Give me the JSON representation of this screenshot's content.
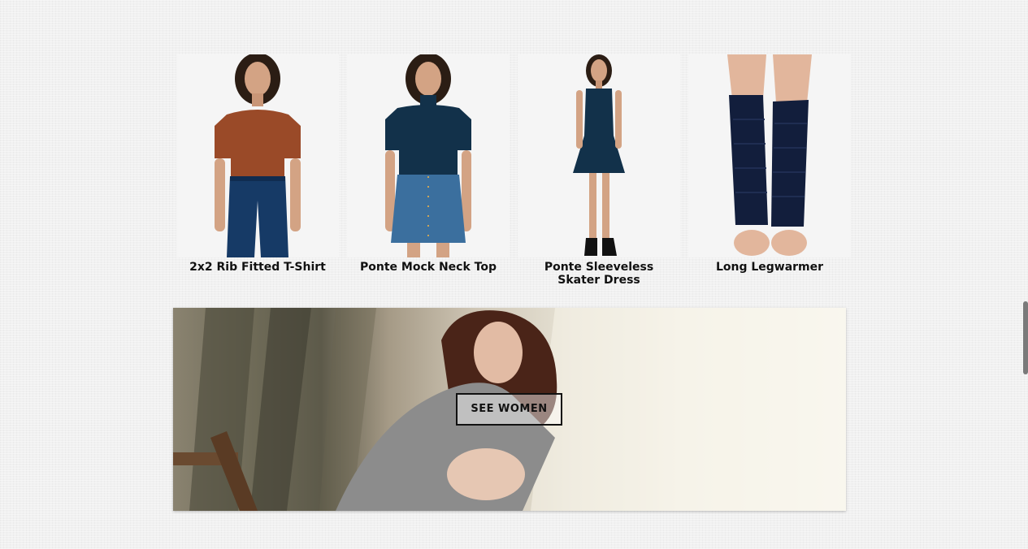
{
  "products": [
    {
      "name": "2x2 Rib Fitted T-Shirt",
      "image_icon": "model-rust-tee-jeans"
    },
    {
      "name": "Ponte Mock Neck Top",
      "image_icon": "model-navy-top-denim-skirt"
    },
    {
      "name": "Ponte Sleeveless Skater Dress",
      "image_icon": "model-navy-skater-dress"
    },
    {
      "name": "Long Legwarmer",
      "image_icon": "legs-navy-legwarmers"
    }
  ],
  "banner": {
    "button_label": "SEE WOMEN",
    "image_icon": "woman-grey-sweater-photo"
  },
  "colors": {
    "background": "#f1f1f1",
    "text": "#111111",
    "rust": "#9a4a28",
    "navy": "#14304a",
    "denim": "#3b6f9e"
  }
}
